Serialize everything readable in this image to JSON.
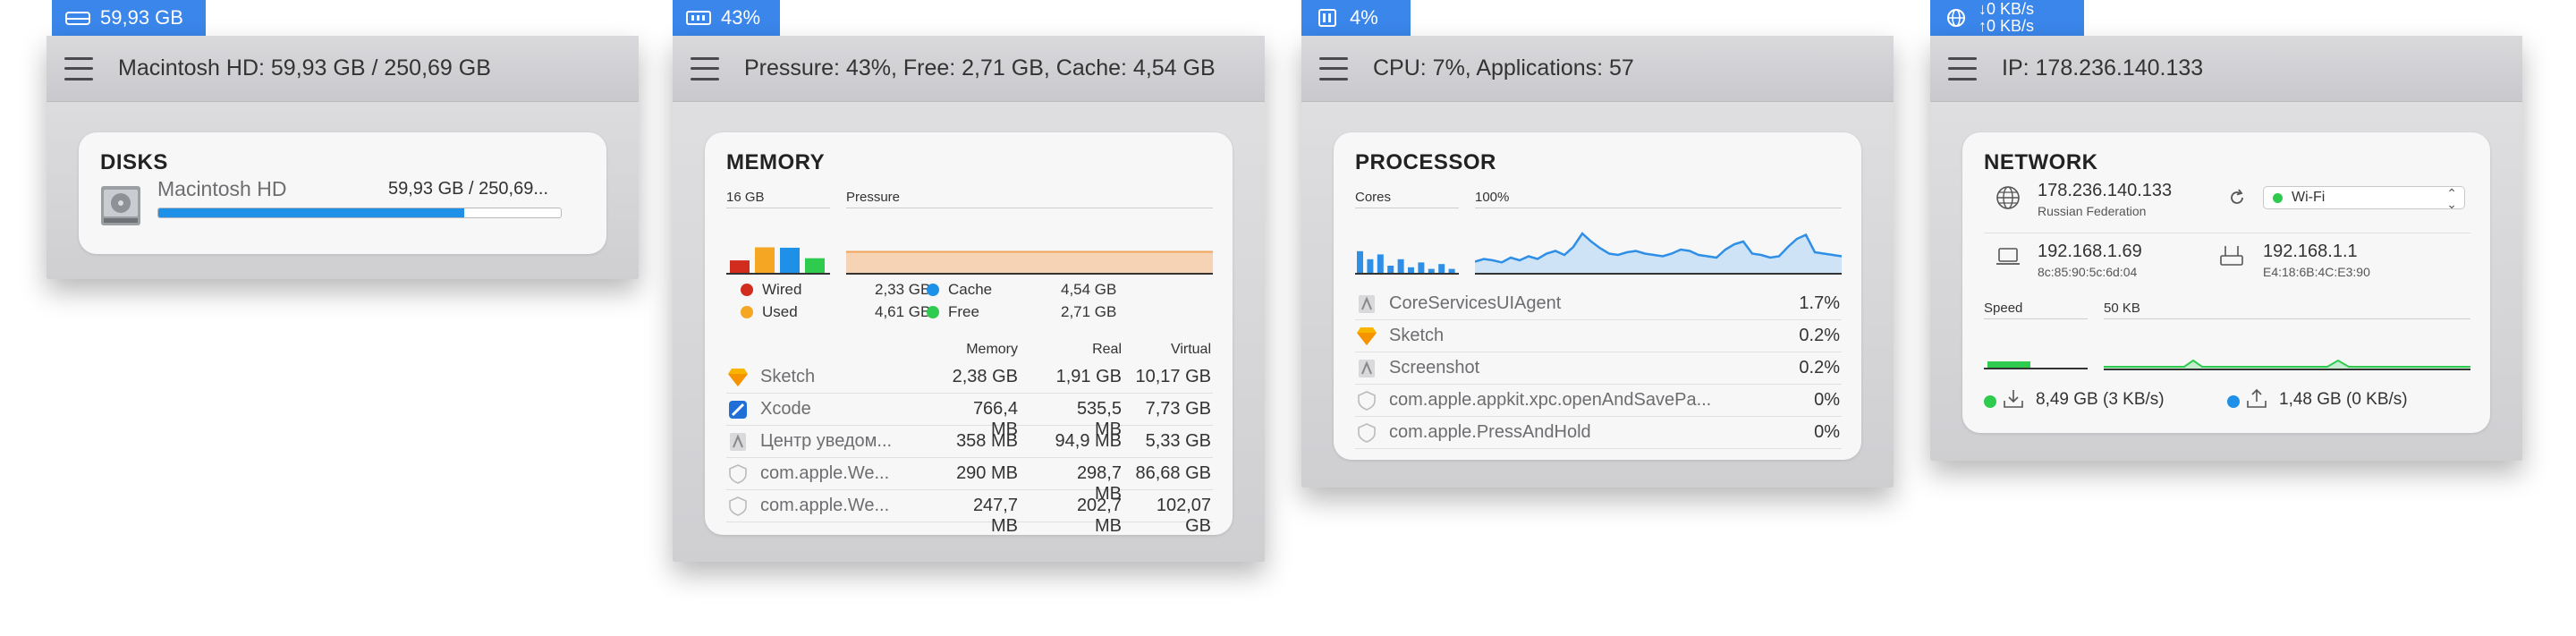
{
  "menubar": {
    "disk_label": "59,93 GB",
    "memory_label": "43%",
    "cpu_label": "4%",
    "net_down": "↓0 KB/s",
    "net_up": "↑0 KB/s"
  },
  "disk": {
    "title": "Macintosh HD: 59,93 GB / 250,69 GB",
    "section": "DISKS",
    "drive_name": "Macintosh HD",
    "drive_usage": "59,93 GB / 250,69...",
    "used_fraction": 0.76
  },
  "memory": {
    "title": "Pressure: 43%, Free: 2,71 GB, Cache: 4,54 GB",
    "section": "MEMORY",
    "total_label": "16 GB",
    "pressure_label": "Pressure",
    "bars": [
      {
        "name": "Wired",
        "color": "#d22c1f",
        "value": 2.33
      },
      {
        "name": "Used",
        "color": "#f5a623",
        "value": 4.61
      },
      {
        "name": "Cache",
        "color": "#1e90e8",
        "value": 4.54
      },
      {
        "name": "Free",
        "color": "#2ecb4f",
        "value": 2.71
      }
    ],
    "pressure_fraction": 0.43,
    "legend": {
      "wired": "Wired",
      "wired_val": "2,33 GB",
      "used": "Used",
      "used_val": "4,61 GB",
      "cache": "Cache",
      "cache_val": "4,54 GB",
      "free": "Free",
      "free_val": "2,71 GB"
    },
    "columns": [
      "Memory",
      "Real",
      "Virtual"
    ],
    "rows": [
      {
        "name": "Sketch",
        "memory": "2,38 GB",
        "real": "1,91 GB",
        "virtual": "10,17 GB"
      },
      {
        "name": "Xcode",
        "memory": "766,4 MB",
        "real": "535,5 MB",
        "virtual": "7,73 GB"
      },
      {
        "name": "Центр уведом...",
        "memory": "358 MB",
        "real": "94,9 MB",
        "virtual": "5,33 GB"
      },
      {
        "name": "com.apple.We...",
        "memory": "290 MB",
        "real": "298,7 MB",
        "virtual": "86,68 GB"
      },
      {
        "name": "com.apple.We...",
        "memory": "247,7 MB",
        "real": "202,7 MB",
        "virtual": "102,07 GB"
      }
    ]
  },
  "cpu": {
    "title": "CPU: 7%, Applications: 57",
    "section": "PROCESSOR",
    "cores_label": "Cores",
    "usage_label": "100%",
    "core_values": [
      28,
      18,
      24,
      10,
      18,
      8,
      14,
      6,
      12,
      6
    ],
    "history": [
      18,
      22,
      20,
      17,
      24,
      20,
      26,
      22,
      30,
      34,
      28,
      40,
      60,
      48,
      38,
      30,
      28,
      32,
      34,
      30,
      28,
      26,
      30,
      36,
      34,
      28,
      26,
      24,
      36,
      44,
      48,
      30,
      28,
      24,
      26,
      40,
      52,
      58,
      32,
      30,
      28,
      26
    ],
    "rows": [
      {
        "name": "CoreServicesUIAgent",
        "value": "1.7%"
      },
      {
        "name": "Sketch",
        "value": "0.2%"
      },
      {
        "name": "Screenshot",
        "value": "0.2%"
      },
      {
        "name": "com.apple.appkit.xpc.openAndSavePa...",
        "value": "0%"
      },
      {
        "name": "com.apple.PressAndHold",
        "value": "0%"
      }
    ]
  },
  "network": {
    "title": "IP: 178.236.140.133",
    "section": "NETWORK",
    "public_ip": "178.236.140.133",
    "country": "Russian Federation",
    "interface": "Wi-Fi",
    "local_ip": "192.168.1.69",
    "local_mac": "8c:85:90:5c:6d:04",
    "router_ip": "192.168.1.1",
    "router_mac": "E4:18:6B:4C:E3:90",
    "speed_label": "Speed",
    "scale_label": "50 KB",
    "download_total": "8,49 GB (3 KB/s)",
    "upload_total": "1,48 GB (0 KB/s)",
    "download_color": "#2ecb4f",
    "upload_color": "#1e90e8"
  }
}
